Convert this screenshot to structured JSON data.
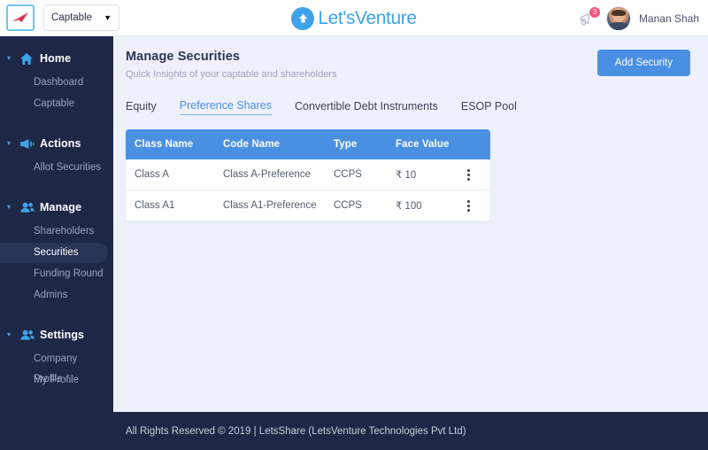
{
  "topbar": {
    "brand_logo_icon": "paper-plane-logo",
    "context_select": {
      "value": "Captable",
      "caret": "▼"
    },
    "product_logo": {
      "icon": "up-arrow-circle-icon",
      "text": "Let'sVenture"
    },
    "notifications": {
      "icon": "megaphone-icon",
      "count": "3"
    },
    "user": {
      "name": "Manan Shah",
      "avatar_icon": "user-avatar"
    }
  },
  "sidebar": {
    "groups": [
      {
        "label": "Home",
        "icon": "home-icon",
        "caret": "▾",
        "items": [
          {
            "label": "Dashboard",
            "active": false
          },
          {
            "label": "Captable",
            "active": false
          }
        ]
      },
      {
        "label": "Actions",
        "icon": "megaphone-icon",
        "caret": "▾",
        "items": [
          {
            "label": "Allot Securities",
            "active": false
          }
        ]
      },
      {
        "label": "Manage",
        "icon": "users-icon",
        "caret": "▾",
        "items": [
          {
            "label": "Shareholders",
            "active": false
          },
          {
            "label": "Securities",
            "active": true
          },
          {
            "label": "Funding Round",
            "active": false
          },
          {
            "label": "Admins",
            "active": false
          }
        ]
      },
      {
        "label": "Settings",
        "icon": "users-icon",
        "caret": "▾",
        "items": [
          {
            "label": "Company Profile",
            "active": false
          },
          {
            "label": "My Profile",
            "active": false
          }
        ]
      }
    ]
  },
  "main": {
    "title": "Manage Securities",
    "subtitle": "Quick Insights of your captable and shareholders",
    "add_button": "Add Security",
    "tabs": [
      {
        "label": "Equity",
        "active": false
      },
      {
        "label": "Preference Shares",
        "active": true
      },
      {
        "label": "Convertible Debt Instruments",
        "active": false
      },
      {
        "label": "ESOP Pool",
        "active": false
      }
    ],
    "table": {
      "columns": [
        "Class Name",
        "Code Name",
        "Type",
        "Face Value",
        ""
      ],
      "rows": [
        {
          "class_name": "Class A",
          "code_name": "Class A-Preference",
          "type": "CCPS",
          "face_value": "₹ 10",
          "actions_icon": "kebab-menu-icon"
        },
        {
          "class_name": "Class A1",
          "code_name": "Class A1-Preference",
          "type": "CCPS",
          "face_value": "₹ 100",
          "actions_icon": "kebab-menu-icon"
        }
      ]
    }
  },
  "footer": {
    "text": "All Rights Reserved © 2019 | LetsShare (LetsVenture Technologies Pvt Ltd)"
  },
  "colors": {
    "sidebar_bg": "#1e2746",
    "accent_blue": "#4a90e2",
    "logo_blue": "#3ea3e8",
    "content_bg": "#eef1fc",
    "badge_pink": "#f5587b",
    "brand_red": "#d9304a"
  }
}
